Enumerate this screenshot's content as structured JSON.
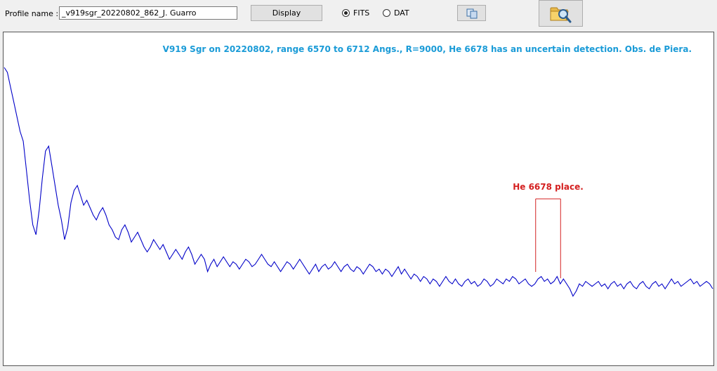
{
  "toolbar": {
    "profile_label": "Profile name :",
    "profile_value": "_v919sgr_20220802_862_J. Guarro",
    "display_label": "Display",
    "fits_label": "FITS",
    "dat_label": "DAT",
    "fits_selected": true,
    "copy_icon": "copy-icon",
    "open_icon": "folder-search-icon"
  },
  "chart_data": {
    "type": "line",
    "title": "V919 Sgr on 20220802, range 6570 to 6712 Angs., R=9000,  He 6678 has an uncertain detection. Obs. de Piera.",
    "annotation": "He 6678 place.",
    "title_color": "#1a9bd7",
    "annotation_color": "#d42020",
    "line_color": "#0000c8",
    "xlim": [
      6570,
      6712
    ],
    "annotation_range": [
      6676.5,
      6681.5
    ],
    "series": [
      {
        "values": [
          1.0,
          0.98,
          0.92,
          0.86,
          0.8,
          0.74,
          0.7,
          0.58,
          0.46,
          0.36,
          0.32,
          0.42,
          0.55,
          0.66,
          0.68,
          0.6,
          0.52,
          0.44,
          0.38,
          0.3,
          0.35,
          0.45,
          0.5,
          0.52,
          0.48,
          0.44,
          0.46,
          0.43,
          0.4,
          0.38,
          0.41,
          0.43,
          0.4,
          0.36,
          0.34,
          0.31,
          0.3,
          0.34,
          0.36,
          0.33,
          0.29,
          0.31,
          0.33,
          0.3,
          0.27,
          0.25,
          0.27,
          0.3,
          0.28,
          0.26,
          0.28,
          0.25,
          0.22,
          0.24,
          0.26,
          0.24,
          0.22,
          0.25,
          0.27,
          0.24,
          0.2,
          0.22,
          0.24,
          0.22,
          0.17,
          0.2,
          0.22,
          0.19,
          0.21,
          0.23,
          0.21,
          0.19,
          0.21,
          0.2,
          0.18,
          0.2,
          0.22,
          0.21,
          0.19,
          0.2,
          0.22,
          0.24,
          0.22,
          0.2,
          0.19,
          0.21,
          0.19,
          0.17,
          0.19,
          0.21,
          0.2,
          0.18,
          0.2,
          0.22,
          0.2,
          0.18,
          0.16,
          0.18,
          0.2,
          0.17,
          0.19,
          0.2,
          0.18,
          0.19,
          0.21,
          0.19,
          0.17,
          0.19,
          0.2,
          0.18,
          0.17,
          0.19,
          0.18,
          0.16,
          0.18,
          0.2,
          0.19,
          0.17,
          0.18,
          0.16,
          0.18,
          0.17,
          0.15,
          0.17,
          0.19,
          0.16,
          0.18,
          0.16,
          0.14,
          0.16,
          0.15,
          0.13,
          0.15,
          0.14,
          0.12,
          0.14,
          0.13,
          0.11,
          0.13,
          0.15,
          0.13,
          0.12,
          0.14,
          0.12,
          0.11,
          0.13,
          0.14,
          0.12,
          0.13,
          0.11,
          0.12,
          0.14,
          0.13,
          0.11,
          0.12,
          0.14,
          0.13,
          0.12,
          0.14,
          0.13,
          0.15,
          0.14,
          0.12,
          0.13,
          0.14,
          0.12,
          0.11,
          0.12,
          0.14,
          0.15,
          0.13,
          0.14,
          0.12,
          0.13,
          0.15,
          0.12,
          0.14,
          0.12,
          0.1,
          0.07,
          0.09,
          0.12,
          0.11,
          0.13,
          0.12,
          0.11,
          0.12,
          0.13,
          0.11,
          0.12,
          0.1,
          0.12,
          0.13,
          0.11,
          0.12,
          0.1,
          0.12,
          0.13,
          0.11,
          0.1,
          0.12,
          0.13,
          0.11,
          0.1,
          0.12,
          0.13,
          0.11,
          0.12,
          0.1,
          0.12,
          0.14,
          0.12,
          0.13,
          0.11,
          0.12,
          0.13,
          0.14,
          0.12,
          0.13,
          0.11,
          0.12,
          0.13,
          0.12,
          0.1
        ]
      }
    ]
  }
}
